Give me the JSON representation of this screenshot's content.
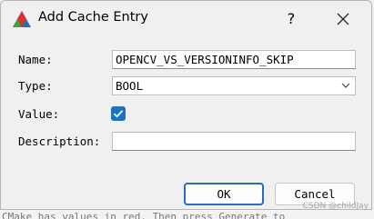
{
  "window": {
    "title": "Add Cache Entry",
    "help_label": "?"
  },
  "fields": {
    "name_label": "Name:",
    "name_value": "OPENCV_VS_VERSIONINFO_SKIP",
    "type_label": "Type:",
    "type_value": "BOOL",
    "value_label": "Value:",
    "value_checked": true,
    "description_label": "Description:",
    "description_value": ""
  },
  "buttons": {
    "ok": "OK",
    "cancel": "Cancel"
  },
  "background_text": "CMake has values in red. Then press Generate to",
  "watermark": "CSDN @childJay",
  "icons": [
    "cmake-logo-icon",
    "help-icon",
    "close-icon",
    "chevron-down-icon",
    "checkmark-icon"
  ],
  "colors": {
    "accent": "#1a73c9",
    "default_button_border": "#2c6bc4"
  }
}
